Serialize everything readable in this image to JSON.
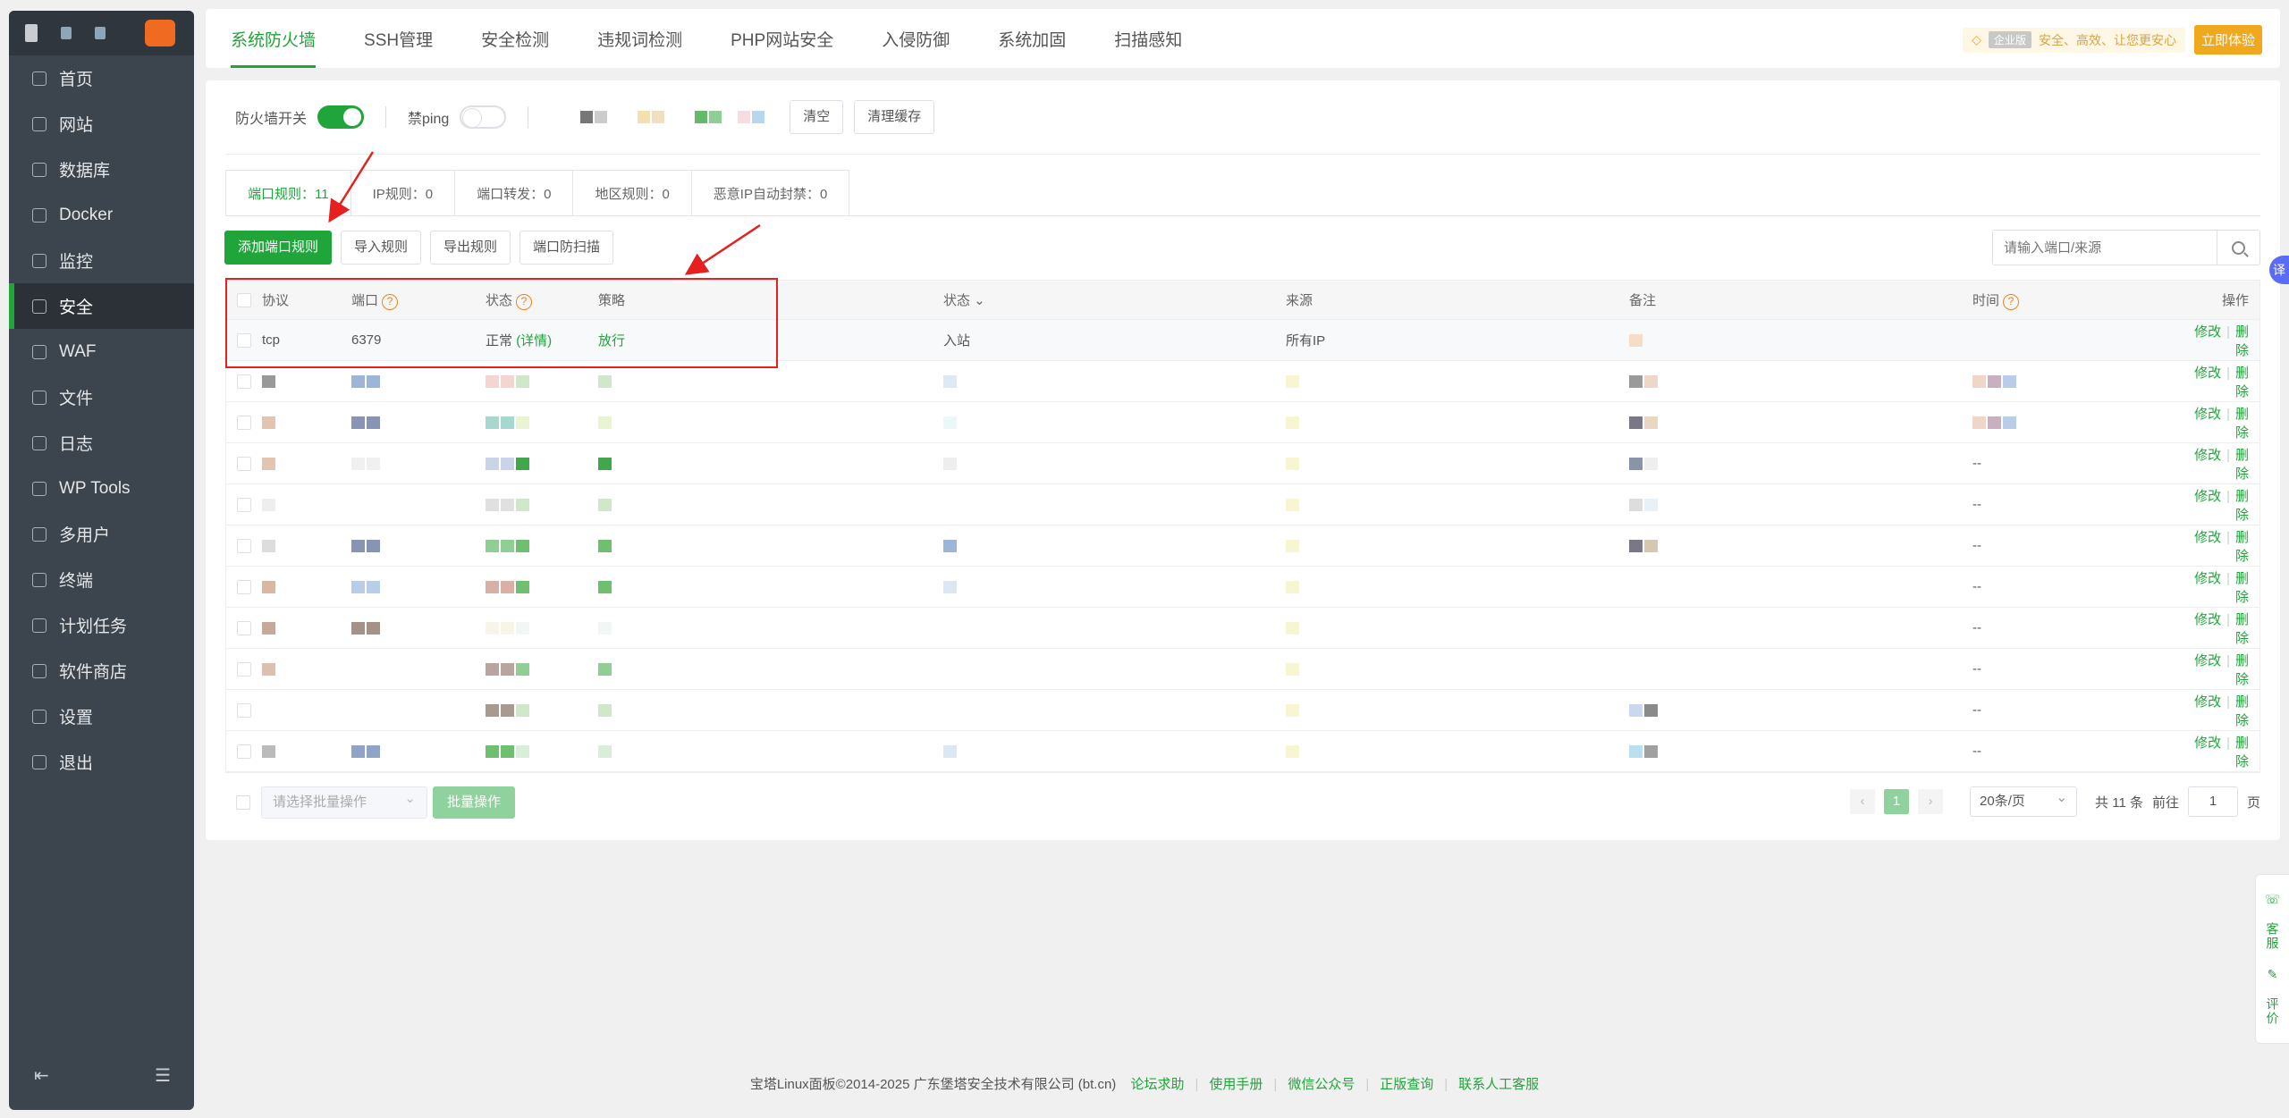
{
  "sidebar": {
    "items": [
      {
        "label": "首页",
        "icon": "home-icon"
      },
      {
        "label": "网站",
        "icon": "globe-icon"
      },
      {
        "label": "数据库",
        "icon": "database-icon"
      },
      {
        "label": "Docker",
        "icon": "docker-icon"
      },
      {
        "label": "监控",
        "icon": "monitor-icon"
      },
      {
        "label": "安全",
        "icon": "shield-icon",
        "active": true
      },
      {
        "label": "WAF",
        "icon": "waf-shield-icon"
      },
      {
        "label": "文件",
        "icon": "folder-icon"
      },
      {
        "label": "日志",
        "icon": "log-icon"
      },
      {
        "label": "WP Tools",
        "icon": "wordpress-icon"
      },
      {
        "label": "多用户",
        "icon": "users-icon"
      },
      {
        "label": "终端",
        "icon": "terminal-icon"
      },
      {
        "label": "计划任务",
        "icon": "calendar-icon"
      },
      {
        "label": "软件商店",
        "icon": "grid-icon"
      },
      {
        "label": "设置",
        "icon": "gear-icon"
      },
      {
        "label": "退出",
        "icon": "logout-icon"
      }
    ]
  },
  "topbar": {
    "tabs": [
      "系统防火墙",
      "SSH管理",
      "安全检测",
      "违规词检测",
      "PHP网站安全",
      "入侵防御",
      "系统加固",
      "扫描感知"
    ],
    "promo_badge": "企业版",
    "promo_text": "安全、高效、让您更安心",
    "promo_button": "立即体验"
  },
  "controls": {
    "firewall_label": "防火墙开关",
    "ping_label": "禁ping",
    "clear_button": "清空",
    "clear_cache_button": "清理缓存"
  },
  "subtabs": [
    "端口规则：11",
    "IP规则：0",
    "端口转发：0",
    "地区规则：0",
    "恶意IP自动封禁：0"
  ],
  "toolbar": {
    "add_rule": "添加端口规则",
    "import_rule": "导入规则",
    "export_rule": "导出规则",
    "port_scan": "端口防扫描",
    "search_placeholder": "请输入端口/来源"
  },
  "table": {
    "headers": {
      "protocol": "协议",
      "port": "端口",
      "status": "状态",
      "policy": "策略",
      "direction": "状态",
      "source": "来源",
      "note": "备注",
      "time": "时间",
      "ops": "操作"
    },
    "first_row": {
      "protocol": "tcp",
      "port": "6379",
      "status": "正常",
      "detail": "(详情)",
      "policy": "放行",
      "direction": "入站",
      "source": "所有IP"
    },
    "edit_label": "修改",
    "delete_label": "删除",
    "time_placeholder": "--"
  },
  "bottom": {
    "batch_placeholder": "请选择批量操作",
    "batch_button": "批量操作",
    "page_current": "1",
    "per_page": "20条/页",
    "total": "共 11 条",
    "goto": "前往",
    "goto_value": "1",
    "page_unit": "页"
  },
  "float": {
    "kefu": "客服",
    "pingjia": "评价",
    "translate": "译"
  },
  "footer": {
    "copyright": "宝塔Linux面板©2014-2025 广东堡塔安全技术有限公司 (bt.cn)",
    "links": [
      "论坛求助",
      "使用手册",
      "微信公众号",
      "正版查询",
      "联系人工客服"
    ]
  },
  "colors": {
    "accent": "#20a53a",
    "sidebar": "#3c444d",
    "annotation": "#e5201f",
    "promo": "#f0a81e"
  }
}
